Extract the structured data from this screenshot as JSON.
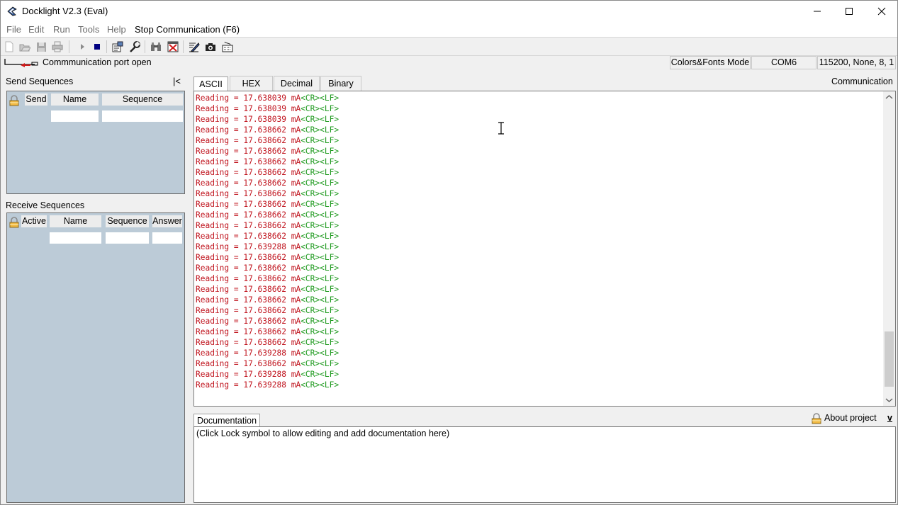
{
  "window": {
    "title": "Docklight V2.3 (Eval)",
    "controls": {
      "minimize": "minimize",
      "maximize": "maximize",
      "close": "close"
    }
  },
  "menu": {
    "items": [
      "File",
      "Edit",
      "Run",
      "Tools",
      "Help"
    ],
    "stop_communication": "Stop Communication  (F6)"
  },
  "toolbar": {
    "icons": [
      "new-file-icon",
      "open-folder-icon",
      "save-icon",
      "print-icon",
      "play-icon",
      "stop-icon",
      "project-settings-icon",
      "options-wrench-icon",
      "find-binoculars-icon",
      "clear-window-icon",
      "edit-notes-icon",
      "snapshot-camera-icon",
      "keyboard-console-icon"
    ]
  },
  "status": {
    "port_status": "Commmunication port open",
    "mode": "Colors&Fonts Mode",
    "port": "COM6",
    "settings": "115200, None, 8, 1"
  },
  "send_sequences": {
    "title": "Send Sequences",
    "collapse_label": "|<",
    "columns": [
      "Send",
      "Name",
      "Sequence"
    ]
  },
  "receive_sequences": {
    "title": "Receive Sequences",
    "columns": [
      "Active",
      "Name",
      "Sequence",
      "Answer"
    ]
  },
  "communication": {
    "label": "Communication",
    "tabs": [
      "ASCII",
      "HEX",
      "Decimal",
      "Binary"
    ],
    "selected_tab": "ASCII",
    "lines": [
      {
        "text": "Reading = 17.638039 mA",
        "ctrl": "<CR><LF>"
      },
      {
        "text": "Reading = 17.638039 mA",
        "ctrl": "<CR><LF>"
      },
      {
        "text": "Reading = 17.638039 mA",
        "ctrl": "<CR><LF>"
      },
      {
        "text": "Reading = 17.638662 mA",
        "ctrl": "<CR><LF>"
      },
      {
        "text": "Reading = 17.638662 mA",
        "ctrl": "<CR><LF>"
      },
      {
        "text": "Reading = 17.638662 mA",
        "ctrl": "<CR><LF>"
      },
      {
        "text": "Reading = 17.638662 mA",
        "ctrl": "<CR><LF>"
      },
      {
        "text": "Reading = 17.638662 mA",
        "ctrl": "<CR><LF>"
      },
      {
        "text": "Reading = 17.638662 mA",
        "ctrl": "<CR><LF>"
      },
      {
        "text": "Reading = 17.638662 mA",
        "ctrl": "<CR><LF>"
      },
      {
        "text": "Reading = 17.638662 mA",
        "ctrl": "<CR><LF>"
      },
      {
        "text": "Reading = 17.638662 mA",
        "ctrl": "<CR><LF>"
      },
      {
        "text": "Reading = 17.638662 mA",
        "ctrl": "<CR><LF>"
      },
      {
        "text": "Reading = 17.638662 mA",
        "ctrl": "<CR><LF>"
      },
      {
        "text": "Reading = 17.639288 mA",
        "ctrl": "<CR><LF>"
      },
      {
        "text": "Reading = 17.638662 mA",
        "ctrl": "<CR><LF>"
      },
      {
        "text": "Reading = 17.638662 mA",
        "ctrl": "<CR><LF>"
      },
      {
        "text": "Reading = 17.638662 mA",
        "ctrl": "<CR><LF>"
      },
      {
        "text": "Reading = 17.638662 mA",
        "ctrl": "<CR><LF>"
      },
      {
        "text": "Reading = 17.638662 mA",
        "ctrl": "<CR><LF>"
      },
      {
        "text": "Reading = 17.638662 mA",
        "ctrl": "<CR><LF>"
      },
      {
        "text": "Reading = 17.638662 mA",
        "ctrl": "<CR><LF>"
      },
      {
        "text": "Reading = 17.638662 mA",
        "ctrl": "<CR><LF>"
      },
      {
        "text": "Reading = 17.638662 mA",
        "ctrl": "<CR><LF>"
      },
      {
        "text": "Reading = 17.639288 mA",
        "ctrl": "<CR><LF>"
      },
      {
        "text": "Reading = 17.638662 mA",
        "ctrl": "<CR><LF>"
      },
      {
        "text": "Reading = 17.639288 mA",
        "ctrl": "<CR><LF>"
      },
      {
        "text": "Reading = 17.639288 mA",
        "ctrl": "<CR><LF>"
      }
    ],
    "scroll_position": 0.97
  },
  "documentation": {
    "tab": "Documentation",
    "about_project": "About project",
    "expand_label": "v",
    "placeholder_text": "(Click Lock symbol to allow editing and add documentation here)"
  },
  "colors": {
    "data_text": "#c0141e",
    "control_chars": "#1f9a1f",
    "sequence_panel_bg": "#bccbd7"
  }
}
